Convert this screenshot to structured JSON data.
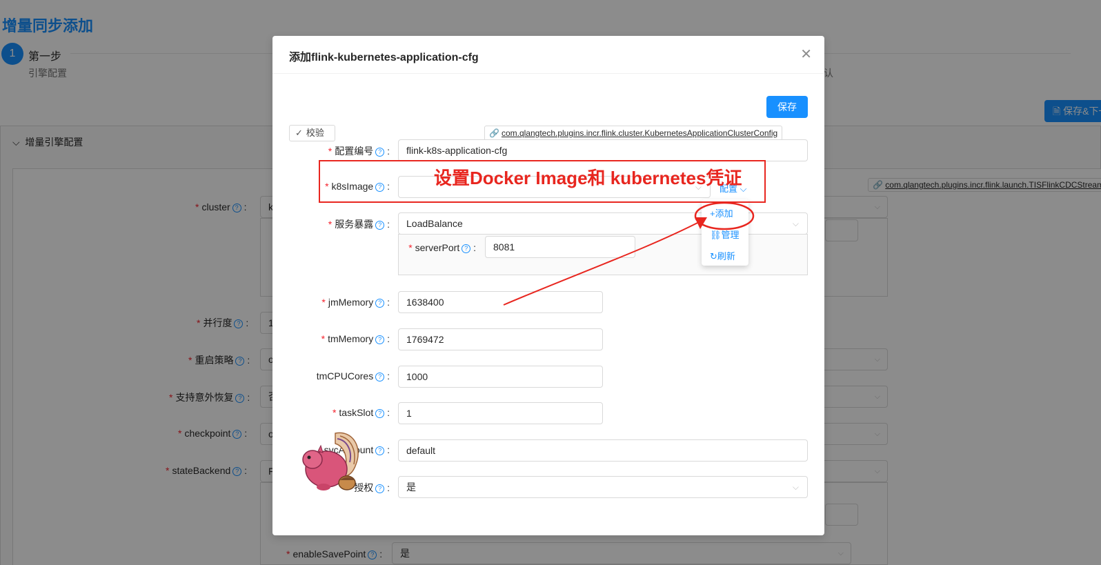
{
  "page": {
    "title": "增量同步添加",
    "step_number": "1",
    "step_title": "第一步",
    "step_desc": "引擎配置",
    "step_desc_right": "确认",
    "save_next_label": "保存&下一步",
    "panel_title": "增量引擎配置",
    "class_link": "com.qlangtech.plugins.incr.flink.launch.TISFlinkCDCStreamFactory",
    "fields": [
      {
        "label": "cluster",
        "required": true,
        "value": "k"
      },
      {
        "label": "并行度",
        "required": true,
        "value": "1"
      },
      {
        "label": "重启策略",
        "required": true,
        "value": "o"
      },
      {
        "label": "支持意外恢复",
        "required": true,
        "value": "否"
      },
      {
        "label": "checkpoint",
        "required": true,
        "value": "o"
      },
      {
        "label": "stateBackend",
        "required": true,
        "value": "F"
      },
      {
        "label": "enableSavePoint",
        "required": true,
        "value": "是"
      }
    ]
  },
  "modal": {
    "title": "添加flink-kubernetes-application-cfg",
    "save_label": "保存",
    "verify_label": "校验",
    "class_link": "com.qlangtech.plugins.incr.flink.cluster.KubernetesApplicationClusterConfig",
    "config_label": "配置",
    "fields": {
      "config_id": {
        "label": "配置编号",
        "value": "flink-k8s-application-cfg"
      },
      "k8s_image": {
        "label": "k8sImage",
        "value": ""
      },
      "service_expose": {
        "label": "服务暴露",
        "value": "LoadBalance"
      },
      "server_port": {
        "label": "serverPort",
        "value": "8081"
      },
      "jm_memory": {
        "label": "jmMemory",
        "value": "1638400"
      },
      "tm_memory": {
        "label": "tmMemory",
        "value": "1769472"
      },
      "tm_cpu_cores": {
        "label": "tmCPUCores",
        "value": "1000"
      },
      "task_slot": {
        "label": "taskSlot",
        "value": "1"
      },
      "svc_account": {
        "label": "svcAccount",
        "value": "default"
      },
      "authorize": {
        "label": "授权",
        "value": "是"
      }
    },
    "dropdown": {
      "add": "添加",
      "manage": "管理",
      "refresh": "刷新"
    },
    "annotation": "设置Docker Image和 kubernetes凭证"
  },
  "colors": {
    "primary": "#1890ff",
    "required": "#f5222d",
    "annotation": "#e8261f",
    "mask": "rgba(0,0,0,0.45)"
  },
  "icons": [
    "close-icon",
    "check-icon",
    "link-icon",
    "help-icon",
    "chevron-down-icon",
    "plus-icon",
    "refresh-icon",
    "flink-squirrel-logo"
  ]
}
